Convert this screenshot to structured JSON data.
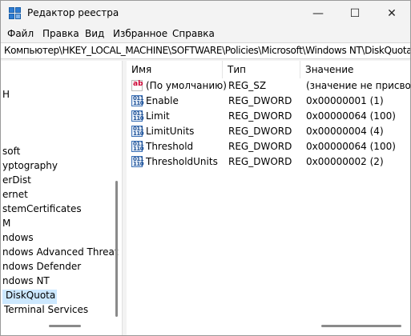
{
  "window": {
    "title": "Редактор реестра",
    "controls": {
      "minimize": "—",
      "maximize": "☐",
      "close": "✕"
    }
  },
  "menu": [
    "Файл",
    "Правка",
    "Вид",
    "Избранное",
    "Справка"
  ],
  "address": "Компьютер\\HKEY_LOCAL_MACHINE\\SOFTWARE\\Policies\\Microsoft\\Windows NT\\DiskQuota",
  "tree": [
    {
      "label": "H"
    },
    {
      "label": "soft"
    },
    {
      "label": "yptography"
    },
    {
      "label": "erDist"
    },
    {
      "label": "ernet"
    },
    {
      "label": "stemCertificates"
    },
    {
      "label": "M"
    },
    {
      "label": "ndows"
    },
    {
      "label": "ndows Advanced Threat"
    },
    {
      "label": "ndows Defender"
    },
    {
      "label": "ndows NT"
    },
    {
      "label": "DiskQuota",
      "selected": true
    },
    {
      "label": "Terminal Services"
    }
  ],
  "columns": {
    "name": "Имя",
    "type": "Тип",
    "value": "Значение"
  },
  "values": [
    {
      "icon": "ab",
      "name": "(По умолчанию)",
      "type": "REG_SZ",
      "value": "(значение не присвоено)"
    },
    {
      "icon": "binary",
      "name": "Enable",
      "type": "REG_DWORD",
      "value": "0x00000001 (1)"
    },
    {
      "icon": "binary",
      "name": "Limit",
      "type": "REG_DWORD",
      "value": "0x00000064 (100)"
    },
    {
      "icon": "binary",
      "name": "LimitUnits",
      "type": "REG_DWORD",
      "value": "0x00000004 (4)"
    },
    {
      "icon": "binary",
      "name": "Threshold",
      "type": "REG_DWORD",
      "value": "0x00000064 (100)"
    },
    {
      "icon": "binary",
      "name": "ThresholdUnits",
      "type": "REG_DWORD",
      "value": "0x00000002 (2)"
    }
  ]
}
